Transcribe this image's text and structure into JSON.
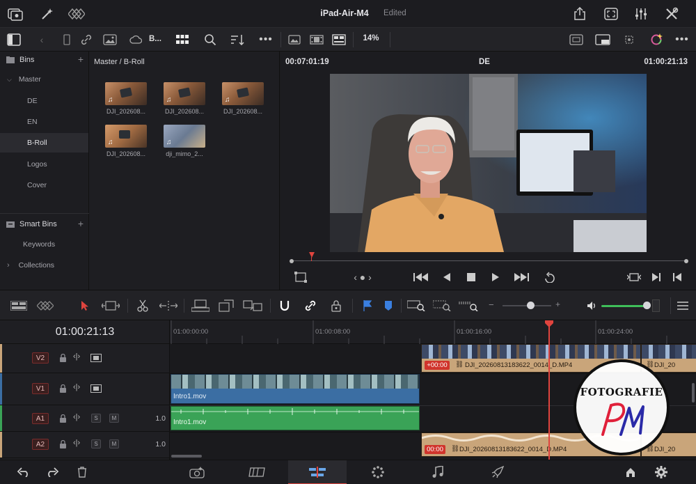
{
  "topbar": {
    "project_name": "iPad-Air-M4",
    "status": "Edited"
  },
  "toolbar": {
    "bin_button_label": "B...",
    "zoom": "14%"
  },
  "sidebar": {
    "bins_label": "Bins",
    "master_label": "Master",
    "items": [
      {
        "label": "DE"
      },
      {
        "label": "EN"
      },
      {
        "label": "B-Roll"
      },
      {
        "label": "Logos"
      },
      {
        "label": "Cover"
      }
    ],
    "smart_bins_label": "Smart Bins",
    "smart_items": [
      {
        "label": "Keywords"
      },
      {
        "label": "Collections"
      }
    ]
  },
  "pool": {
    "breadcrumb": "Master / B-Roll",
    "clips": [
      {
        "name": "DJI_202608..."
      },
      {
        "name": "DJI_202608..."
      },
      {
        "name": "DJI_202608..."
      },
      {
        "name": "DJI_202608..."
      },
      {
        "name": "dji_mimo_2..."
      }
    ]
  },
  "viewer": {
    "source_tc": "00:07:01:19",
    "clip_label": "DE",
    "timeline_tc": "01:00:21:13"
  },
  "timeline": {
    "current_tc": "01:00:21:13",
    "ruler": [
      "01:00:00:00",
      "01:00:08:00",
      "01:00:16:00",
      "01:00:24:00"
    ],
    "tracks": [
      {
        "id": "V2",
        "vol": ""
      },
      {
        "id": "V1",
        "vol": ""
      },
      {
        "id": "A1",
        "vol": "1.0"
      },
      {
        "id": "A2",
        "vol": "1.0"
      }
    ],
    "s_label": "S",
    "m_label": "M",
    "clips": {
      "v2_offset": "+00:00",
      "v2_name": "DJI_20260813183622_0014_D.MP4",
      "v2_name_2": "DJI_20",
      "v1_name": "Intro1.mov",
      "a1_name": "Intro1.mov",
      "a2_offset": "00:00",
      "a2_name": "DJI_20260813183622_0014_D.MP4",
      "a2_name_2": "DJI_20"
    }
  },
  "watermark": {
    "line1": "FOTOGRAFIE",
    "mark": "PM"
  },
  "colors": {
    "playhead": "#e0443e",
    "audio_green": "#3aa357",
    "clip_tan": "#c9a57a",
    "video_blue": "#3b6ea3",
    "volume_green": "#3fbf5a"
  }
}
